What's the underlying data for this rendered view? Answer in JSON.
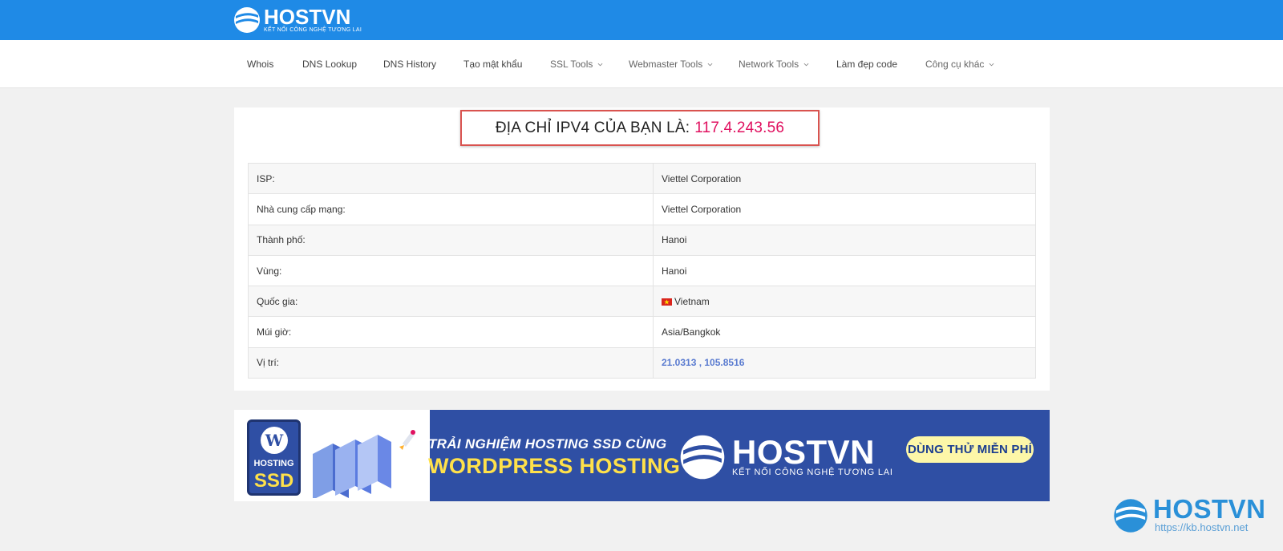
{
  "header": {
    "logo_name": "HOSTVN",
    "logo_tagline": "KẾT NỐI CÔNG NGHỆ TƯƠNG LAI"
  },
  "nav": {
    "items": [
      {
        "label": "Whois"
      },
      {
        "label": "DNS Lookup"
      },
      {
        "label": "DNS History"
      },
      {
        "label": "Tạo mật khẩu"
      },
      {
        "label": "SSL Tools"
      },
      {
        "label": "Webmaster Tools"
      },
      {
        "label": "Network Tools"
      },
      {
        "label": "Làm đẹp code"
      },
      {
        "label": "Công cụ khác"
      }
    ]
  },
  "ip_result": {
    "label": "ĐỊA CHỈ IPV4 CỦA BẠN LÀ:",
    "value": "117.4.243.56",
    "value_color": "#e0105f"
  },
  "info_table": {
    "rows": [
      {
        "key": "ISP:",
        "value": "Viettel Corporation"
      },
      {
        "key": "Nhà cung cấp mạng:",
        "value": "Viettel Corporation"
      },
      {
        "key": "Thành phố:",
        "value": "Hanoi"
      },
      {
        "key": "Vùng:",
        "value": "Hanoi"
      },
      {
        "key": "Quốc gia:",
        "value": "Vietnam",
        "icon": "vietnam-flag-icon"
      },
      {
        "key": "Múi giờ:",
        "value": "Asia/Bangkok"
      },
      {
        "key": "Vị trí:",
        "value": "21.0313 , 105.8516"
      }
    ]
  },
  "banner": {
    "badge_top": "HOSTING",
    "badge_bottom": "SSD",
    "headline": "TRẢI NGHIỆM HOSTING SSD CÙNG",
    "product": "WORDPRESS HOSTING",
    "logo_name": "HOSTVN",
    "logo_tagline": "KẾT NỐI CÔNG NGHỆ TƯƠNG LAI",
    "cta": "DÙNG THỬ MIỄN PHÍ"
  },
  "watermark": {
    "name": "HOSTVN",
    "url": "https://kb.hostvn.net"
  },
  "colors": {
    "topbar": "#1f8ae6",
    "banner": "#2f4fa4",
    "highlight_border": "#d9534f"
  }
}
